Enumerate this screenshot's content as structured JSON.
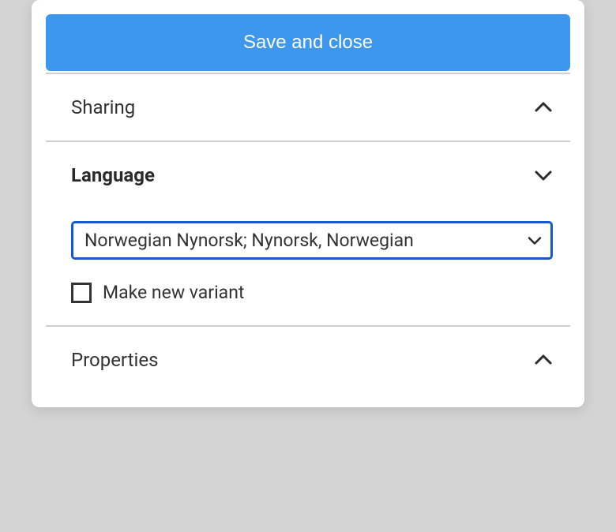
{
  "save_button_label": "Save and close",
  "sections": {
    "sharing": {
      "title": "Sharing",
      "expanded": false
    },
    "language": {
      "title": "Language",
      "expanded": true,
      "selected": "Norwegian Nynorsk; Nynorsk, Norwegian",
      "checkbox_label": "Make new variant",
      "checkbox_checked": false
    },
    "properties": {
      "title": "Properties",
      "expanded": false
    }
  }
}
